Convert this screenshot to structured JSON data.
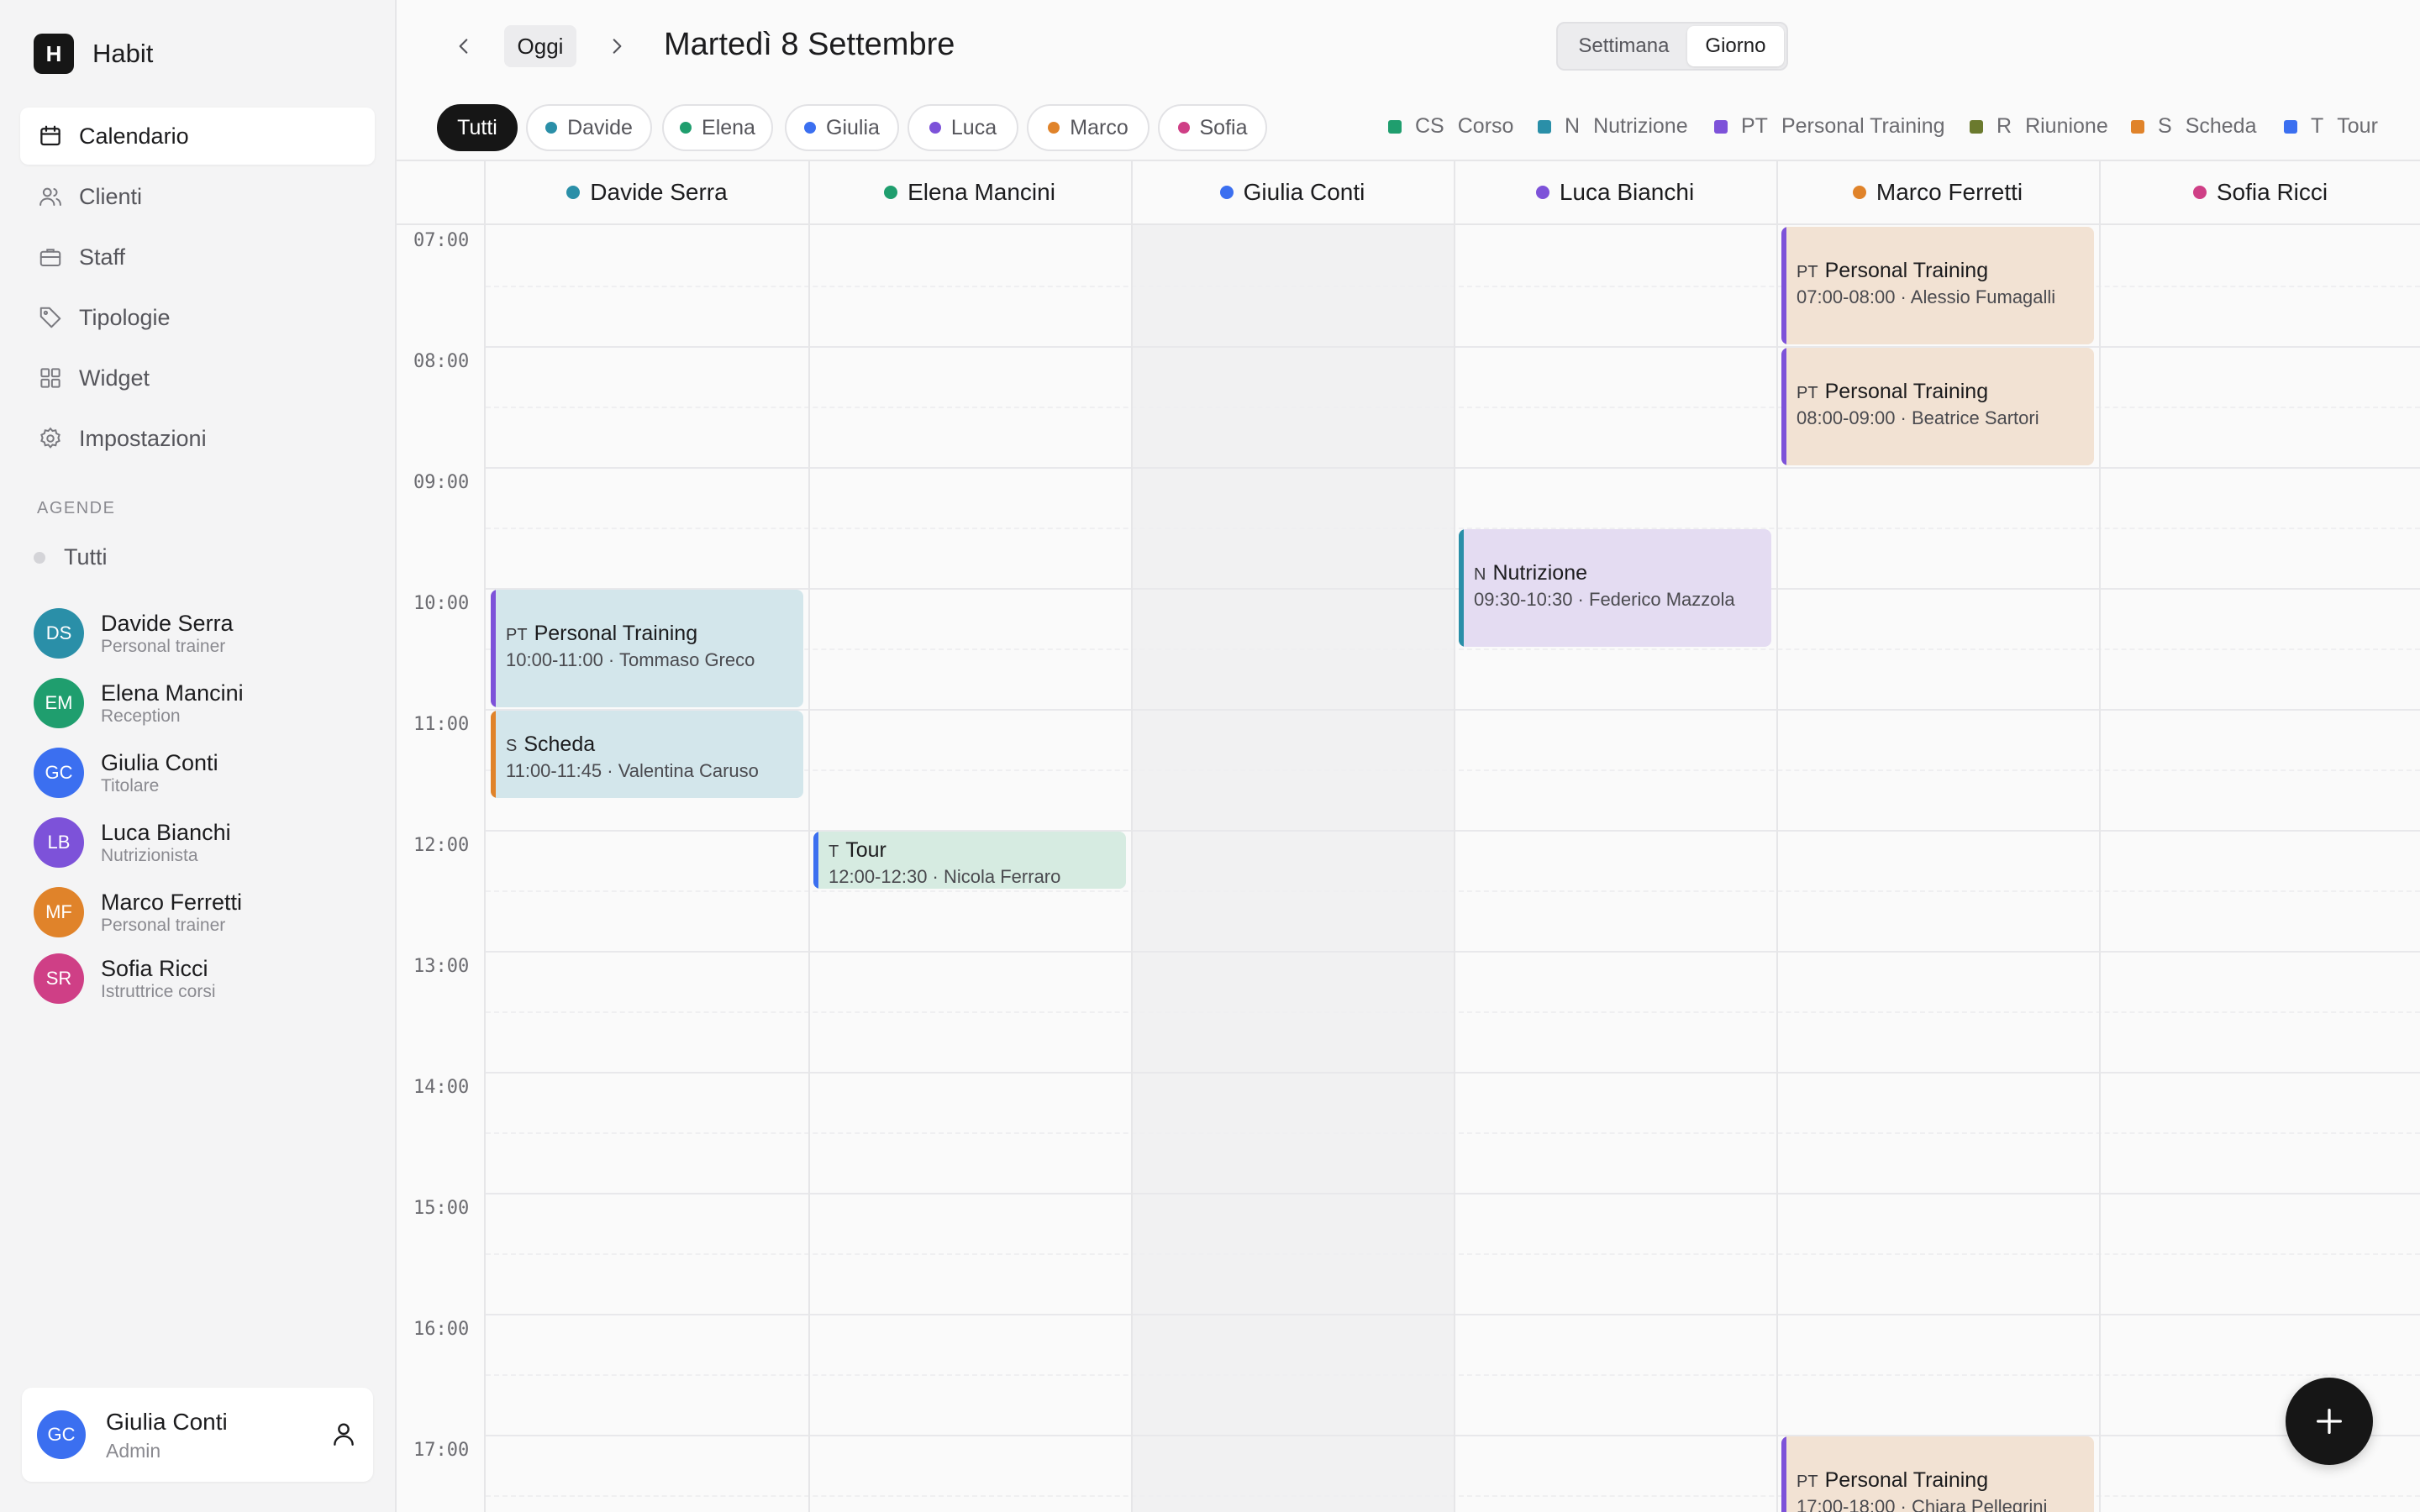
{
  "app": {
    "logo_letter": "H",
    "name": "Habit"
  },
  "nav": [
    {
      "label": "Calendario",
      "icon": "calendar-icon",
      "active": true
    },
    {
      "label": "Clienti",
      "icon": "users-icon",
      "active": false
    },
    {
      "label": "Staff",
      "icon": "briefcase-icon",
      "active": false
    },
    {
      "label": "Tipologie",
      "icon": "tag-icon",
      "active": false
    },
    {
      "label": "Widget",
      "icon": "grid-icon",
      "active": false
    },
    {
      "label": "Impostazioni",
      "icon": "gear-icon",
      "active": false
    }
  ],
  "agende": {
    "section_label": "AGENDE",
    "all_label": "Tutti",
    "staff": [
      {
        "initials": "DS",
        "name": "Davide Serra",
        "role": "Personal trainer",
        "color": "#2a8fa8"
      },
      {
        "initials": "EM",
        "name": "Elena Mancini",
        "role": "Reception",
        "color": "#1f9e6e"
      },
      {
        "initials": "GC",
        "name": "Giulia Conti",
        "role": "Titolare",
        "color": "#3b6ff0"
      },
      {
        "initials": "LB",
        "name": "Luca Bianchi",
        "role": "Nutrizionista",
        "color": "#7d52d9"
      },
      {
        "initials": "MF",
        "name": "Marco Ferretti",
        "role": "Personal trainer",
        "color": "#e0832a"
      },
      {
        "initials": "SR",
        "name": "Sofia Ricci",
        "role": "Istruttrice corsi",
        "color": "#cf3f86"
      }
    ]
  },
  "current_user": {
    "initials": "GC",
    "name": "Giulia Conti",
    "role": "Admin",
    "color": "#3b6ff0"
  },
  "toolbar": {
    "today_label": "Oggi",
    "date_title": "Martedì 8 Settembre",
    "view_options": [
      "Settimana",
      "Giorno"
    ],
    "active_view": "Giorno"
  },
  "filters": [
    {
      "label": "Tutti",
      "color": null,
      "active": true
    },
    {
      "label": "Davide",
      "color": "#2a8fa8",
      "active": false
    },
    {
      "label": "Elena",
      "color": "#1f9e6e",
      "active": false
    },
    {
      "label": "Giulia",
      "color": "#3b6ff0",
      "active": false
    },
    {
      "label": "Luca",
      "color": "#7d52d9",
      "active": false
    },
    {
      "label": "Marco",
      "color": "#e0832a",
      "active": false
    },
    {
      "label": "Sofia",
      "color": "#cf3f86",
      "active": false
    }
  ],
  "legend": [
    {
      "code": "CS",
      "label": "Corso",
      "color": "#1f9e6e"
    },
    {
      "code": "N",
      "label": "Nutrizione",
      "color": "#2a8fa8"
    },
    {
      "code": "PT",
      "label": "Personal Training",
      "color": "#7d52d9"
    },
    {
      "code": "R",
      "label": "Riunione",
      "color": "#6b7a2e"
    },
    {
      "code": "S",
      "label": "Scheda",
      "color": "#e0832a"
    },
    {
      "code": "T",
      "label": "Tour",
      "color": "#3b6ff0"
    }
  ],
  "calendar": {
    "columns": [
      {
        "name": "Davide Serra",
        "color": "#2a8fa8",
        "blocked": false
      },
      {
        "name": "Elena Mancini",
        "color": "#1f9e6e",
        "blocked": false
      },
      {
        "name": "Giulia Conti",
        "color": "#3b6ff0",
        "blocked": true
      },
      {
        "name": "Luca Bianchi",
        "color": "#7d52d9",
        "blocked": false
      },
      {
        "name": "Marco Ferretti",
        "color": "#e0832a",
        "blocked": false
      },
      {
        "name": "Sofia Ricci",
        "color": "#cf3f86",
        "blocked": false
      }
    ],
    "hours": [
      "07:00",
      "08:00",
      "09:00",
      "10:00",
      "11:00",
      "12:00",
      "13:00",
      "14:00",
      "15:00",
      "16:00",
      "17:00"
    ],
    "events": [
      {
        "column": 4,
        "start": "07:00",
        "end": "08:00",
        "code": "PT",
        "title": "Personal Training",
        "time": "07:00-08:00",
        "client": "Alessio Fumagalli",
        "bg": "#f2e2d3",
        "bar": "#7d52d9"
      },
      {
        "column": 4,
        "start": "08:00",
        "end": "09:00",
        "code": "PT",
        "title": "Personal Training",
        "time": "08:00-09:00",
        "client": "Beatrice Sartori",
        "bg": "#f2e2d3",
        "bar": "#7d52d9"
      },
      {
        "column": 3,
        "start": "09:30",
        "end": "10:30",
        "code": "N",
        "title": "Nutrizione",
        "time": "09:30-10:30",
        "client": "Federico Mazzola",
        "bg": "#e4dcf2",
        "bar": "#2a8fa8"
      },
      {
        "column": 0,
        "start": "10:00",
        "end": "11:00",
        "code": "PT",
        "title": "Personal Training",
        "time": "10:00-11:00",
        "client": "Tommaso Greco",
        "bg": "#d3e6eb",
        "bar": "#7d52d9"
      },
      {
        "column": 0,
        "start": "11:00",
        "end": "11:45",
        "code": "S",
        "title": "Scheda",
        "time": "11:00-11:45",
        "client": "Valentina Caruso",
        "bg": "#d3e6eb",
        "bar": "#e0832a"
      },
      {
        "column": 1,
        "start": "12:00",
        "end": "12:30",
        "code": "T",
        "title": "Tour",
        "time": "12:00-12:30",
        "client": "Nicola Ferraro",
        "bg": "#d6ebe1",
        "bar": "#3b6ff0"
      },
      {
        "column": 4,
        "start": "17:00",
        "end": "18:00",
        "code": "PT",
        "title": "Personal Training",
        "time": "17:00-18:00",
        "client": "Chiara Pellegrini",
        "bg": "#f2e2d3",
        "bar": "#7d52d9"
      }
    ]
  }
}
